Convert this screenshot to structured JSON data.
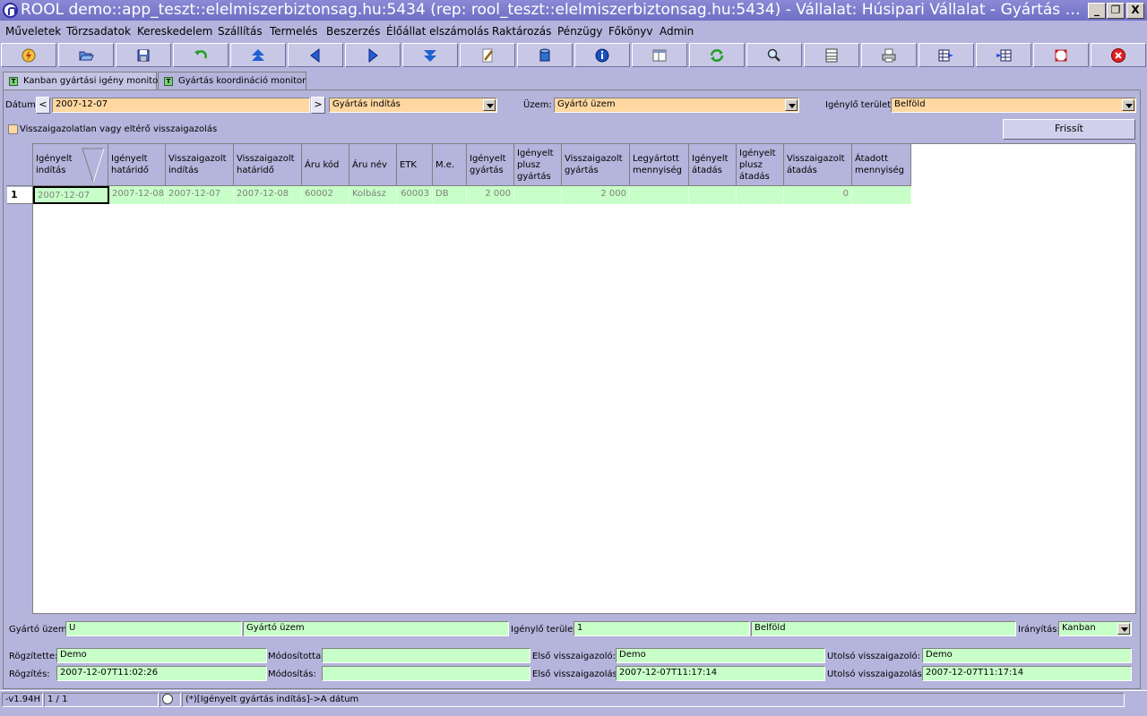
{
  "window": {
    "title": "ROOL demo::app_teszt::elelmiszerbiztonsag.hu:5434 (rep: rool_teszt::elelmiszerbiztonsag.hu:5434) - Vállalat: Húsipari Vállalat - Gyártás koor...",
    "min_label": "_",
    "max_label": "❐",
    "close_label": "X"
  },
  "menu": [
    "Műveletek",
    "Törzsadatok",
    "Kereskedelem",
    "Szállítás",
    "Termelés",
    "Beszerzés",
    "Élőállat elszámolás",
    "Raktározás",
    "Pénzügy",
    "Főkönyv",
    "Admin"
  ],
  "toolbar": [
    "lightning-icon",
    "open-folder-icon",
    "save-icon",
    "undo-icon",
    "first-record-icon",
    "previous-icon",
    "next-icon",
    "last-record-icon",
    "edit-icon",
    "database-icon",
    "info-icon",
    "layout-icon",
    "refresh-icon",
    "search-icon",
    "columns-icon",
    "print-icon",
    "grid-export-icon",
    "grid-import-icon",
    "fullscreen-icon",
    "close-icon"
  ],
  "tabs": [
    {
      "label": "Kanban gyártási igény monitor",
      "icon_letter": "T"
    },
    {
      "label": "Gyártás koordináció monitor",
      "icon_letter": "T"
    }
  ],
  "filters": {
    "date_label": "Dátum:",
    "date_value": "2007-12-07",
    "prev": "<",
    "next": ">",
    "date_type": "Gyártás indítás",
    "plant_label": "Üzem:",
    "plant_value": "Gyártó üzem",
    "area_label": "Igénylő terület:",
    "area_value": "Belföld",
    "checkbox_label": "Visszaigazolatlan vagy eltérő visszaigazolás",
    "refresh_label": "Frissít"
  },
  "grid": {
    "columns": [
      "Igényelt indítás",
      "Igényelt határidő",
      "Visszaigazolt indítás",
      "Visszaigazolt határidő",
      "Áru kód",
      "Áru név",
      "ETK",
      "M.e.",
      "Igényelt gyártás",
      "Igényelt plusz gyártás",
      "Visszaigazolt gyártás",
      "Legyártott mennyiség",
      "Igényelt átadás",
      "Igényelt plusz átadás",
      "Visszaigazolt átadás",
      "Átadott mennyiség"
    ],
    "rows": [
      {
        "num": "1",
        "cells": [
          "2007-12-07",
          "2007-12-08",
          "2007-12-07",
          "2007-12-08",
          "60002",
          "Kolbász",
          "60003",
          "DB",
          "2 000",
          "",
          "2 000",
          "",
          "",
          "",
          "0",
          ""
        ]
      }
    ]
  },
  "detail": {
    "plant_label": "Gyártó üzem:",
    "plant_code": "U",
    "plant_name": "Gyártó üzem",
    "area_label": "Igénylő terület:",
    "area_code": "1",
    "area_name": "Belföld",
    "direction_label": "Irányítás:",
    "direction_value": "Kanban",
    "recorded_by_label": "Rögzítette:",
    "recorded_by": "Demo",
    "modified_by_label": "Módosította:",
    "modified_by": "",
    "first_confirmer_label": "Első visszaigazoló:",
    "first_confirmer": "Demo",
    "last_confirmer_label": "Utolsó visszaigazoló:",
    "last_confirmer": "Demo",
    "recorded_label": "Rögzítés:",
    "recorded": "2007-12-07T11:02:26",
    "modified_label": "Módosítás:",
    "modified": "",
    "first_confirm_label": "Első visszaigazolás:",
    "first_confirm": "2007-12-07T11:17:14",
    "last_confirm_label": "Utolsó visszaigazolás:",
    "last_confirm": "2007-12-07T11:17:14"
  },
  "status": {
    "version": "-v1.94H",
    "position": "1 / 1",
    "sort": "(*)[Igényelt gyártás indítás]->A dátum"
  }
}
